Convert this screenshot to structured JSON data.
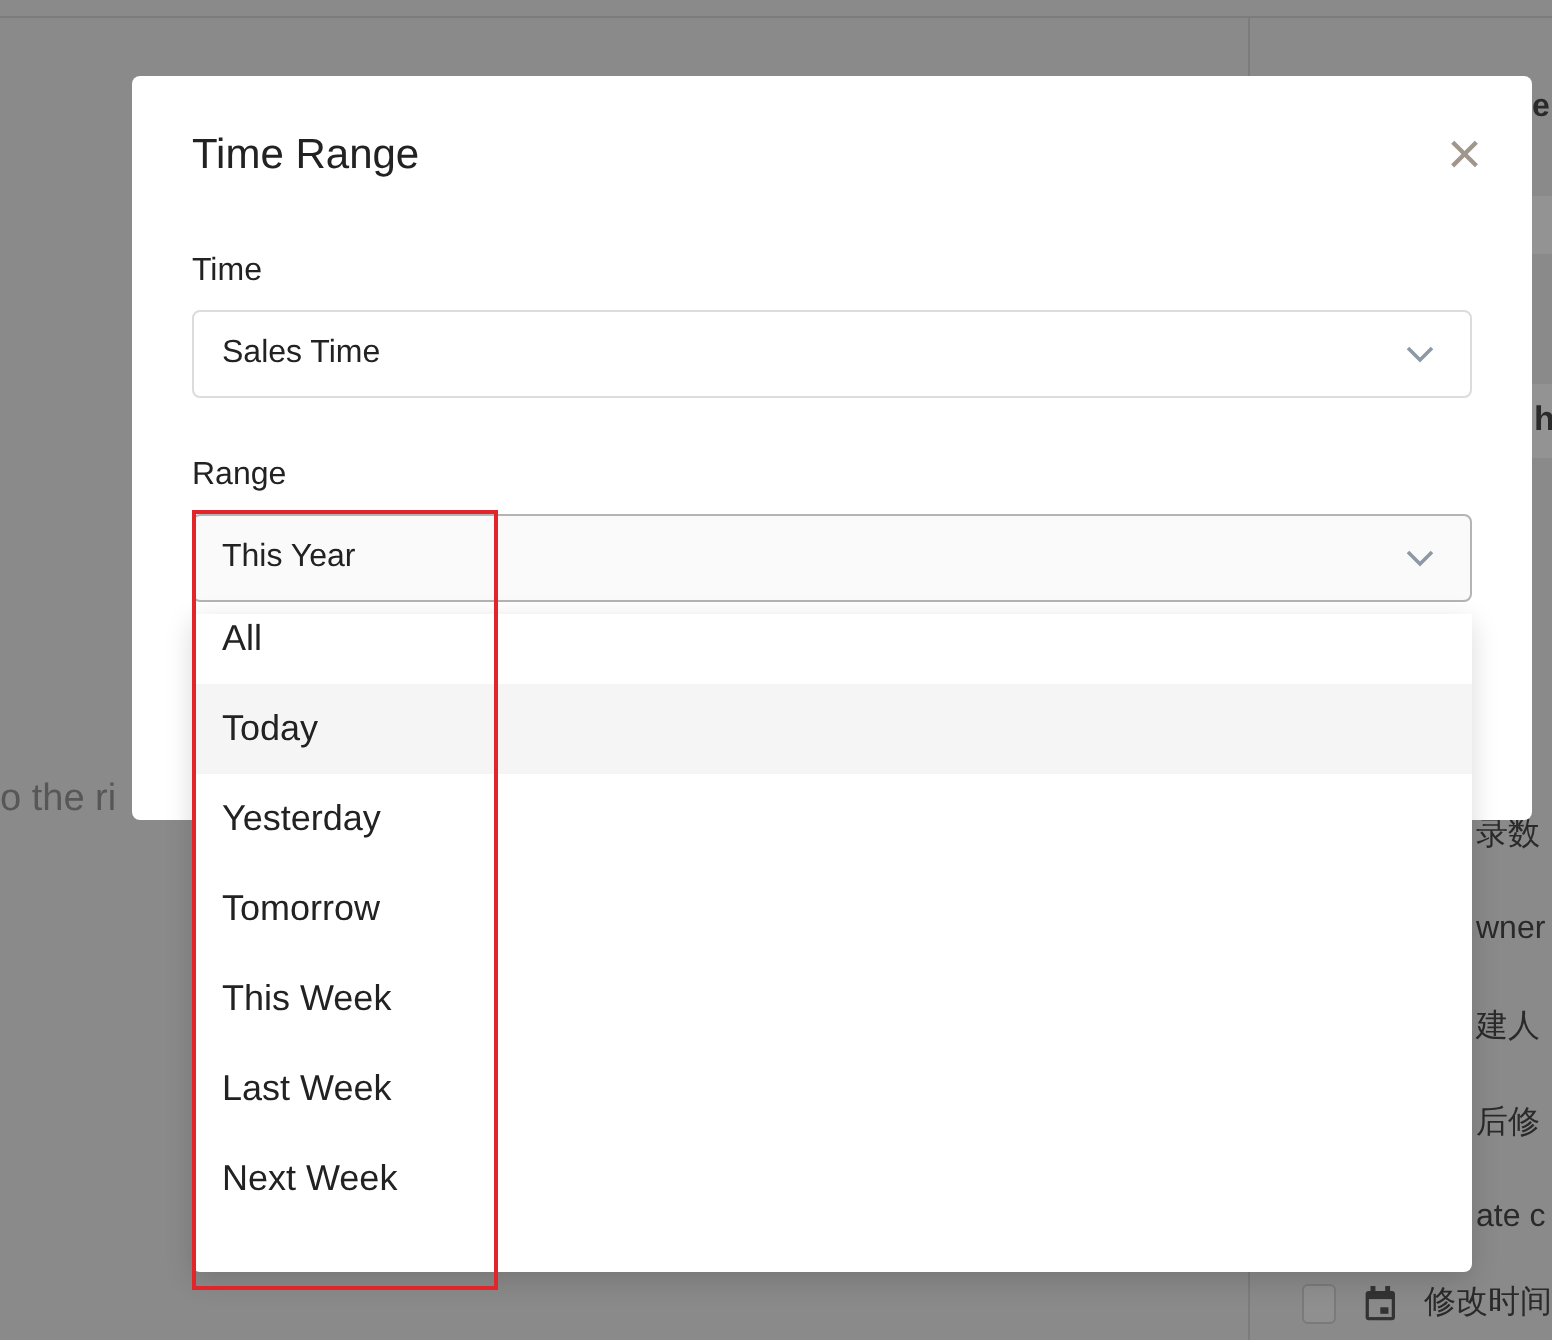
{
  "background": {
    "left_text": "o the ri",
    "panel_heading": "e",
    "band_rows": [
      {
        "text": "h"
      }
    ],
    "field_rows": [
      "录数",
      "wner",
      "建人",
      "后修",
      "ate c"
    ],
    "last_row": {
      "checked": false,
      "text": "修改时间"
    }
  },
  "dialog": {
    "title": "Time Range",
    "close": "×",
    "fields": [
      {
        "label": "Time",
        "value": "Sales Time",
        "open": false
      },
      {
        "label": "Range",
        "value": "This Year",
        "open": true,
        "options": [
          {
            "label": "All",
            "highlighted": false
          },
          {
            "label": "Today",
            "highlighted": true
          },
          {
            "label": "Yesterday",
            "highlighted": false
          },
          {
            "label": "Tomorrow",
            "highlighted": false
          },
          {
            "label": "This Week",
            "highlighted": false
          },
          {
            "label": "Last Week",
            "highlighted": false
          },
          {
            "label": "Next Week",
            "highlighted": false
          }
        ]
      }
    ]
  }
}
